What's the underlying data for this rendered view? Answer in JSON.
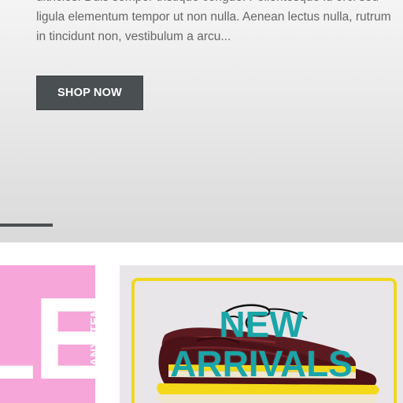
{
  "hero": {
    "description": "ultricies. Duis semper tristique congue. Pellentesque id orci sed ligula elementum tempor ut non nulla. Aenean lectus nulla, rutrum in tincidunt non, vestibulum a arcu...",
    "shop_now_label": "SHOP NOW",
    "slider_progress": 0.13
  },
  "promo_sale": {
    "big_text": "LE",
    "side_text": "MANY ITEMS",
    "background": "#f6a6d9"
  },
  "promo_new": {
    "line1": "NEW",
    "line2": "ARRIVALS",
    "text_color": "#1aa5a8",
    "frame_color": "#f0d820"
  }
}
